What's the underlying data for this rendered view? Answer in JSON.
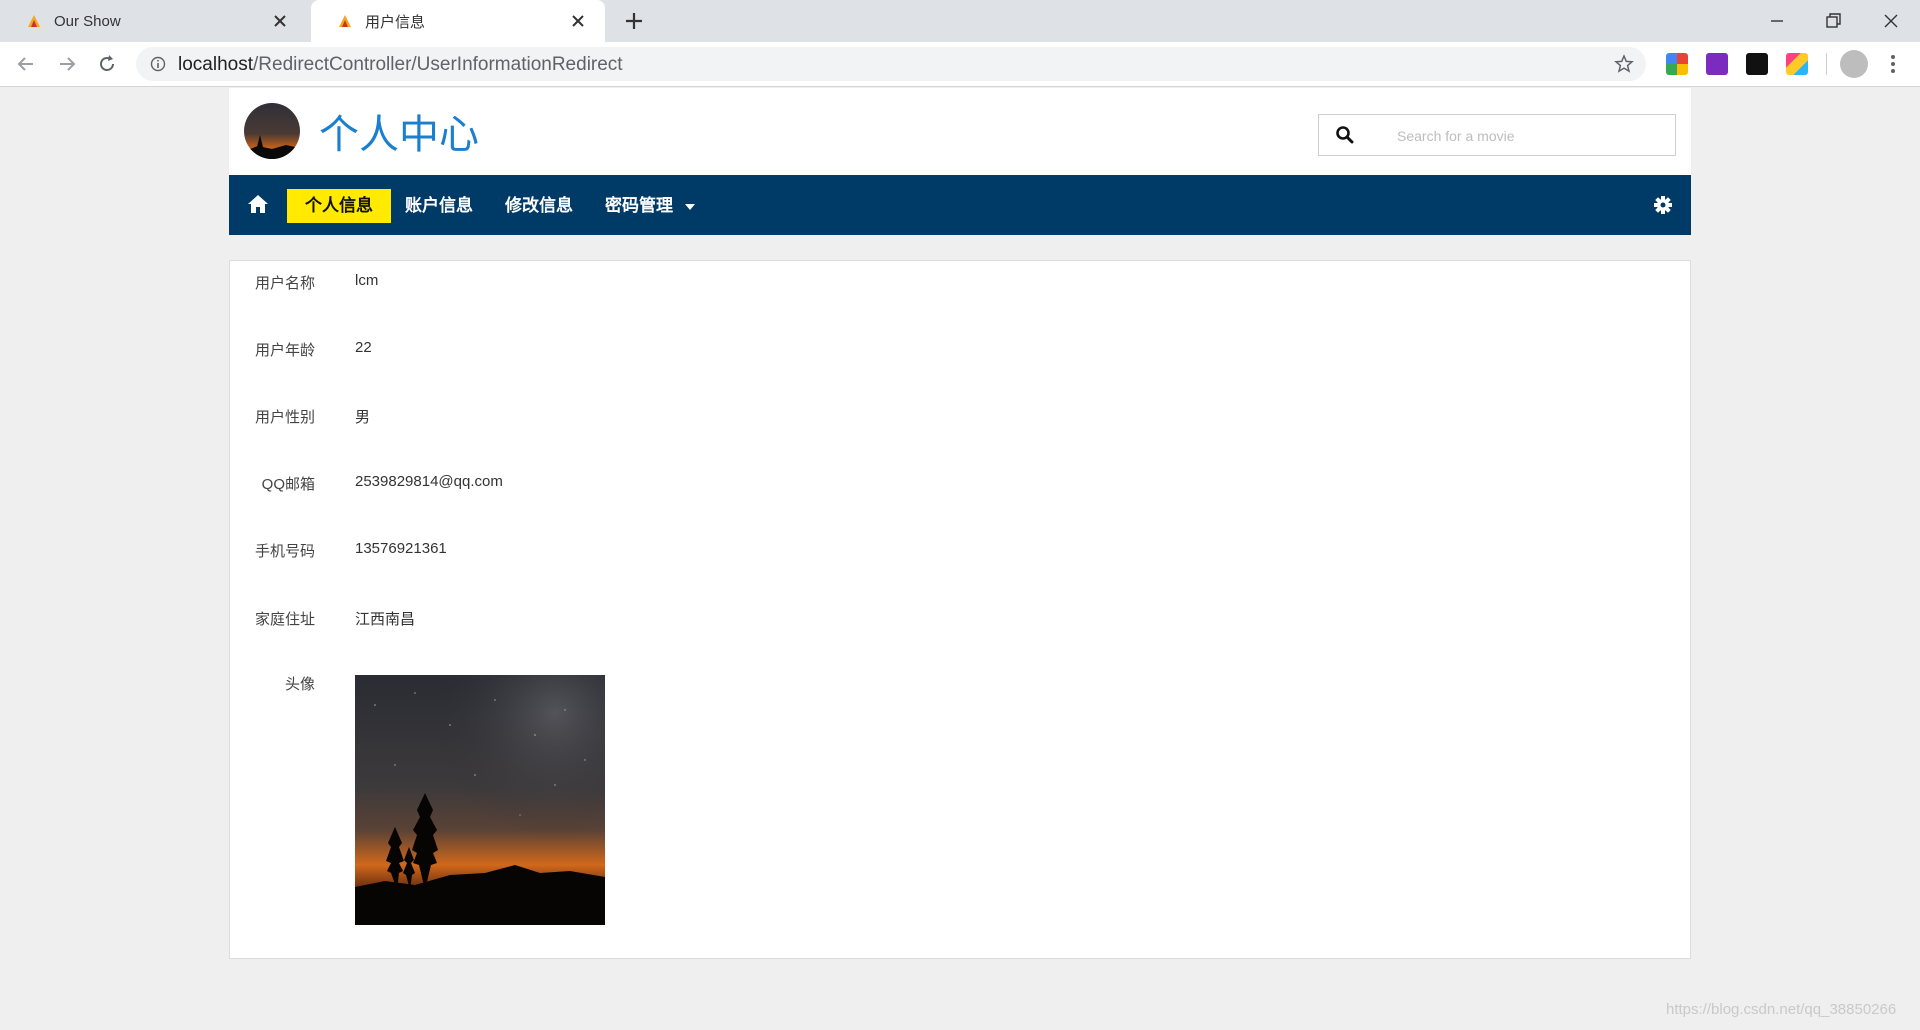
{
  "browser": {
    "tabs": [
      {
        "title": "Our Show",
        "active": false
      },
      {
        "title": "用户信息",
        "active": true
      }
    ],
    "url_host": "localhost",
    "url_path": "/RedirectController/UserInformationRedirect"
  },
  "header": {
    "brand": "个人中心",
    "search_placeholder": "Search for a movie"
  },
  "nav": {
    "items": [
      "个人信息",
      "账户信息",
      "修改信息",
      "密码管理"
    ],
    "active_index": 0,
    "active_color": "#ffea00",
    "bar_color": "#003a67"
  },
  "profile": {
    "fields": [
      {
        "label": "用户名称",
        "value": "lcm"
      },
      {
        "label": "用户年龄",
        "value": "22"
      },
      {
        "label": "用户性别",
        "value": "男"
      },
      {
        "label": "QQ邮箱",
        "value": "2539829814@qq.com"
      },
      {
        "label": "手机号码",
        "value": "13576921361"
      },
      {
        "label": "家庭住址",
        "value": "江西南昌"
      }
    ],
    "avatar_label": "头像"
  },
  "watermark": "https://blog.csdn.net/qq_38850266",
  "icons": {
    "home": "home-icon",
    "settings": "gear-icon",
    "search": "search-icon",
    "dropdown": "caret-down-icon"
  }
}
